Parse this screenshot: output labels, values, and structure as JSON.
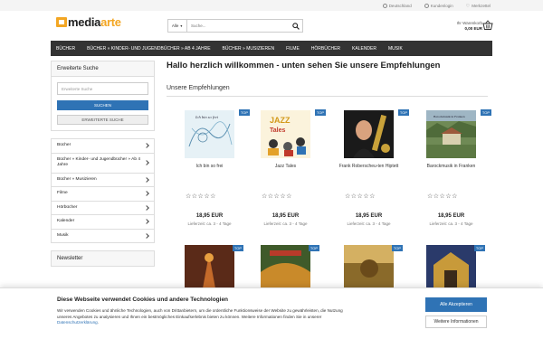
{
  "topbar": {
    "country": "Deutschland",
    "account": "Kundenlogin",
    "wishlist": "Merkzettel"
  },
  "logo": {
    "part1": "media",
    "part2": "arte"
  },
  "search": {
    "category": "Alle",
    "placeholder": "Suche..."
  },
  "cart": {
    "label": "Ihr Warenkorb",
    "amount": "0,00 EUR"
  },
  "nav": [
    "BÜCHER",
    "BÜCHER » KINDER- UND JUGENDBÜCHER » AB 4 JAHRE",
    "BÜCHER » MUSIZIEREN",
    "FILME",
    "HÖRBÜCHER",
    "KALENDER",
    "MUSIK"
  ],
  "sidebar": {
    "search_title": "Erweiterte Suche",
    "search_placeholder": "Erweiterte Suche",
    "search_button": "SUCHEN",
    "advanced_button": "ERWEITERTE SUCHE",
    "categories": [
      "Bücher",
      "Bücher » Kinder- und Jugendbücher » Ab 4 Jahre",
      "Bücher » Musizieren",
      "Filme",
      "Hörbücher",
      "Kalender",
      "Musik"
    ],
    "newsletter_title": "Newsletter"
  },
  "main": {
    "heading": "Hallo herzlich willkommen - unten sehen Sie unsere Empfehlungen",
    "subheading": "Unsere Empfehlungen"
  },
  "products": [
    {
      "name": "Ich bin so frei",
      "price": "18,95 EUR",
      "delivery": "Lieferzeit: ca. 3 - 4 Tage",
      "badge": "TOP",
      "stars": "☆☆☆☆☆"
    },
    {
      "name": "Jazz Tales",
      "price": "18,95 EUR",
      "delivery": "Lieferzeit: ca. 3 - 4 Tage",
      "badge": "TOP",
      "stars": "☆☆☆☆☆"
    },
    {
      "name": "Frank Roberscheu-ten Hiptett",
      "price": "18,95 EUR",
      "delivery": "Lieferzeit: ca. 3 - 4 Tage",
      "badge": "TOP",
      "stars": "☆☆☆☆☆"
    },
    {
      "name": "Barockmusik in Franken",
      "price": "18,95 EUR",
      "delivery": "Lieferzeit: ca. 3 - 4 Tage",
      "badge": "TOP",
      "stars": "☆☆☆☆☆"
    }
  ],
  "row2_badges": [
    "TOP",
    "TOP",
    "TOP",
    "TOP"
  ],
  "cookie": {
    "title": "Diese Webseite verwendet Cookies und andere Technologien",
    "text": "Wir verwenden Cookies und ähnliche Technologien, auch von Drittanbietern, um die ordentliche Funktionsweise der Website zu gewährleisten, die Nutzung unseres Angebotes zu analysieren und Ihnen ein bestmögliches Einkaufserlebnis bieten zu können. Weitere Informationen finden Sie in unserer",
    "link": "Datenschutzerklärung",
    "accept": "Alle Akzeptieren",
    "more": "Weitere Informationen"
  },
  "colors": {
    "accent": "#2f73b5",
    "logo_orange": "#f3a623",
    "nav_bg": "#333333"
  }
}
